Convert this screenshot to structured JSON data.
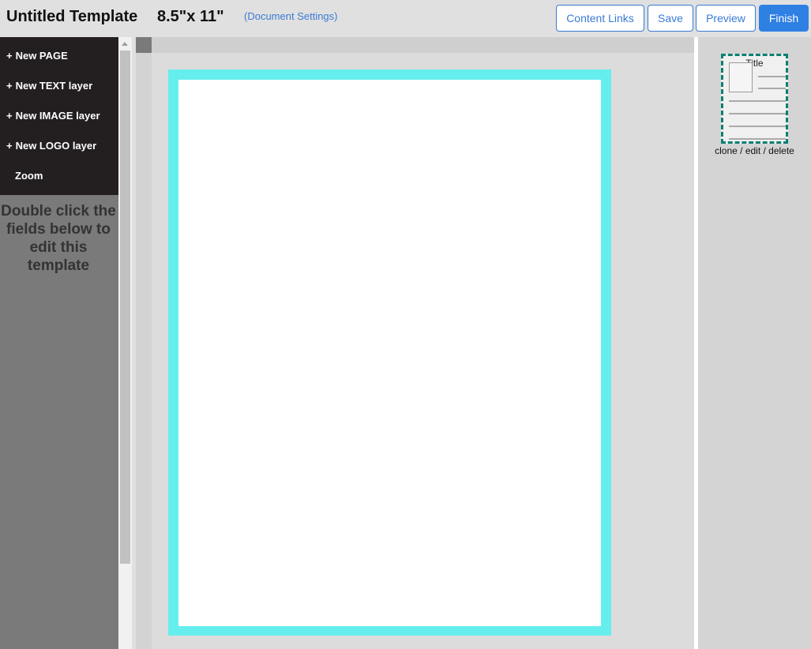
{
  "header": {
    "title": "Untitled Template",
    "size": "8.5\"x 11\"",
    "doc_settings": "(Document Settings)",
    "buttons": {
      "content_links": "Content Links",
      "save": "Save",
      "preview": "Preview",
      "finish": "Finish"
    }
  },
  "sidebar": {
    "items": [
      {
        "label": "New PAGE",
        "prefix": "+"
      },
      {
        "label": "New TEXT layer",
        "prefix": "+"
      },
      {
        "label": "New IMAGE layer",
        "prefix": "+"
      },
      {
        "label": "New LOGO layer",
        "prefix": "+"
      },
      {
        "label": "Zoom"
      }
    ],
    "hint": "Double click the fields below to edit this template"
  },
  "right_panel": {
    "thumbnail_title": "Title",
    "actions": "clone / edit / delete"
  },
  "colors": {
    "accent": "#2f80e3",
    "page_border": "#66eeee",
    "thumbnail_border": "#0c7f73",
    "menu_bg": "#231f20"
  }
}
